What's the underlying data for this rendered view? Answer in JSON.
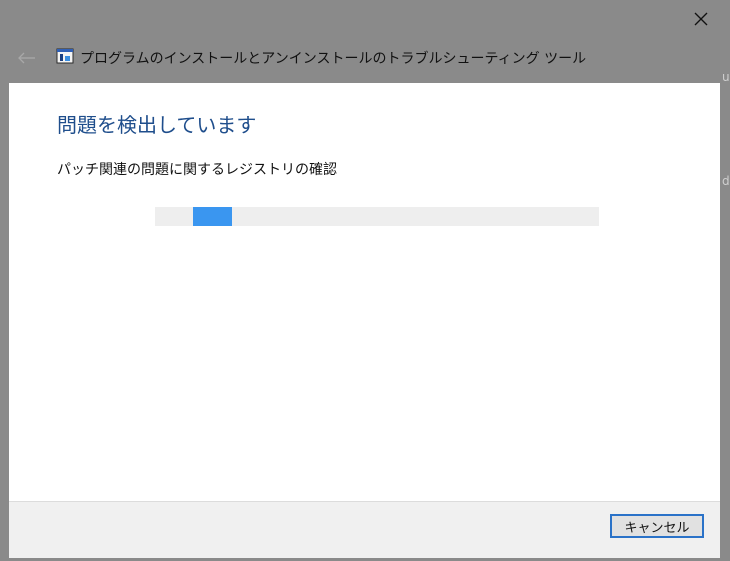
{
  "window": {
    "title": "プログラムのインストールとアンインストールのトラブルシューティング ツール"
  },
  "main": {
    "heading": "問題を検出しています",
    "status_text": "パッチ関連の問題に関するレジストリの確認"
  },
  "footer": {
    "cancel_label": "キャンセル"
  },
  "background_edge": {
    "char_top": "u",
    "char_bottom": "d"
  },
  "colors": {
    "heading": "#1f4e8c",
    "progress_chunk": "#3a96f0",
    "titlebar": "#8a8a8a"
  },
  "icons": {
    "close": "close-icon",
    "back": "back-arrow-icon",
    "app": "troubleshooter-app-icon"
  }
}
